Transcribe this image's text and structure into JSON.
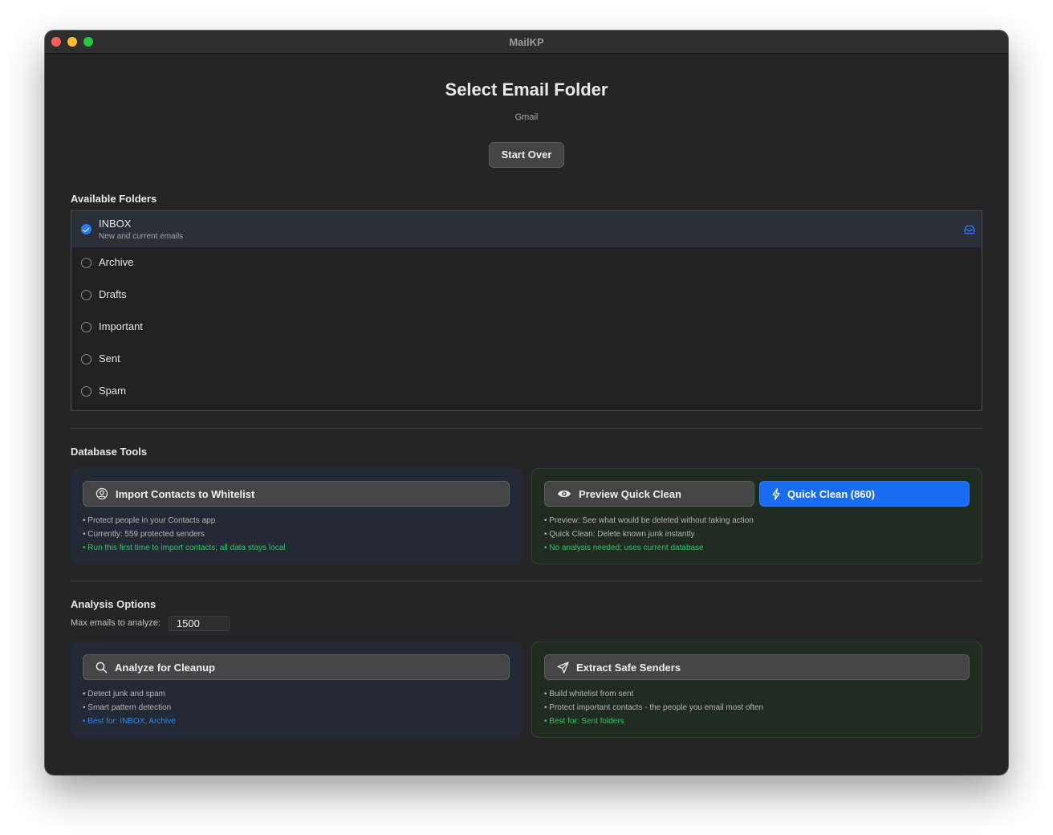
{
  "window": {
    "title": "MailKP"
  },
  "header": {
    "title": "Select Email Folder",
    "account": "Gmail",
    "start_over_label": "Start Over"
  },
  "folders": {
    "section_title": "Available Folders",
    "items": [
      {
        "name": "INBOX",
        "description": "New and current emails",
        "selected": true
      },
      {
        "name": "Archive",
        "selected": false
      },
      {
        "name": "Drafts",
        "selected": false
      },
      {
        "name": "Important",
        "selected": false
      },
      {
        "name": "Sent",
        "selected": false
      },
      {
        "name": "Spam",
        "selected": false
      }
    ]
  },
  "database_tools": {
    "section_title": "Database Tools",
    "import": {
      "button_label": "Import Contacts to Whitelist",
      "bullets": [
        "• Protect people in your Contacts app",
        "• Currently: 559 protected senders",
        "• Run this first time to import contacts; all data stays local"
      ]
    },
    "quick_clean": {
      "preview_label": "Preview Quick Clean",
      "clean_label": "Quick Clean (860)",
      "bullets": [
        "• Preview: See what would be deleted without taking action",
        "• Quick Clean: Delete known junk instantly",
        "• No analysis needed; uses current database"
      ]
    }
  },
  "analysis": {
    "section_title": "Analysis Options",
    "max_label": "Max emails to analyze:",
    "max_value": "1500",
    "analyze": {
      "button_label": "Analyze for Cleanup",
      "bullets": [
        "• Detect junk and spam",
        "• Smart pattern detection",
        "• Best for: INBOX, Archive"
      ]
    },
    "extract": {
      "button_label": "Extract Safe Senders",
      "bullets": [
        "• Build whitelist from sent",
        "• Protect important contacts - the people you email most often",
        "• Best for: Sent folders"
      ]
    }
  },
  "colors": {
    "accent_blue": "#1a6cf0",
    "success_green": "#36c463",
    "window_bg": "#252525"
  },
  "icons": {
    "inbox_row": "inbox-tray-icon",
    "import": "contacts-icon",
    "preview": "eye-icon",
    "quick_clean": "bolt-icon",
    "analyze": "magnifier-icon",
    "extract": "paper-plane-icon"
  }
}
